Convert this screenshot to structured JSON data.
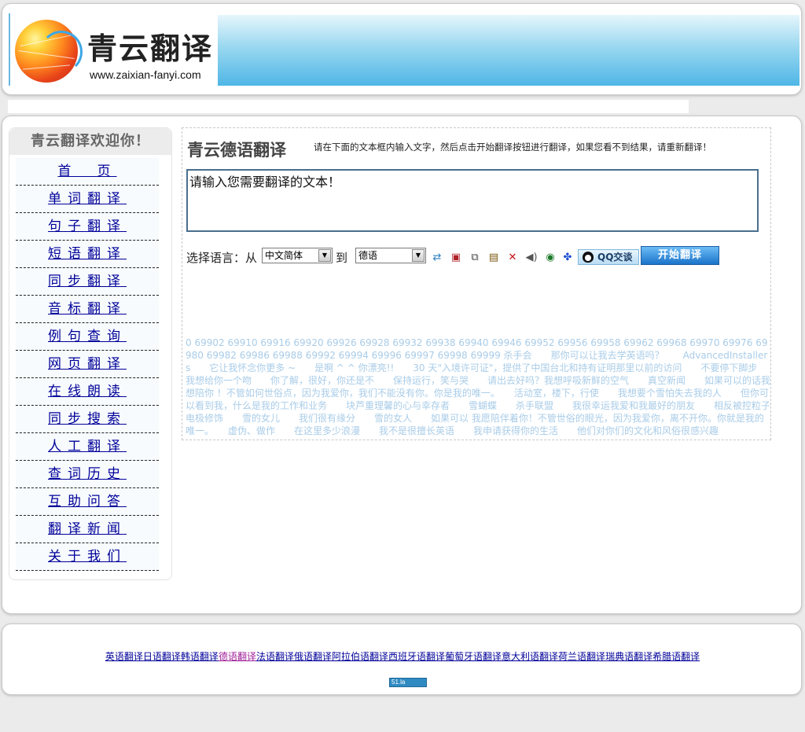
{
  "header": {
    "logo_title": "青云翻译",
    "logo_url": "www.zaixian-fanyi.com"
  },
  "sidebar": {
    "title": "青云翻译欢迎你！",
    "items": [
      {
        "label": "首　页"
      },
      {
        "label": "单词翻译"
      },
      {
        "label": "句子翻译"
      },
      {
        "label": "短语翻译"
      },
      {
        "label": "同步翻译"
      },
      {
        "label": "音标翻译"
      },
      {
        "label": "例句查询"
      },
      {
        "label": "网页翻译"
      },
      {
        "label": "在线朗读"
      },
      {
        "label": "同步搜索"
      },
      {
        "label": "人工翻译"
      },
      {
        "label": "查词历史"
      },
      {
        "label": "互助问答"
      },
      {
        "label": "翻译新闻"
      },
      {
        "label": "关于我们"
      }
    ]
  },
  "translator": {
    "title": "青云德语翻译",
    "hint": "请在下面的文本框内输入文字，然后点击开始翻译按钮进行翻译，如果您看不到结果，请重新翻译！",
    "input_value": "请输入您需要翻译的文本！",
    "select_label": "选择语言：从",
    "to_label": "到",
    "from_lang": "中文简体",
    "to_lang": "德语",
    "qq_label": "QQ交谈",
    "translate_button": "开始翻译"
  },
  "keywords": "0 69902 69910 69916 69920 69926 69928 69932 69938 69940 69946 69952 69956 69958 69962 69968 69970 69976 69980 69982 69986 69988 69992 69994 69996 69997 69998 69999 杀手会　　那你可以让我去学英语吗？　　AdvancedInstallers　　它让我怀念你更多 ~　　是啊 ^ ^ 你漂亮!!　　30 天\"入境许可证\"，提供了中国台北和持有证明那里以前的访问　　不要停下脚步　　我想给你一个吻　　你了解，很好，你还是不　　保持运行，笑与哭　　请出去好吗？我想呼吸新鲜的空气　　真空新闻　　如果可以的话我想陪你 ！不管如何世俗点，因为我爱你，我们不能没有你。你是我的唯一。　　活动室，楼下，行使　　我想要个雪怕失去我的人　　但你可以看到我，什么是我的工作和业务　　块芦重理馨的心与幸存者　　雪蝴蝶　　杀手联盟　　我很幸运我爱和我最好的朋友　　相反被控粒子电极修饰　　雪的女儿　　我们很有缘分　　雪的女人　　如果可以 我愿陪伴着你！不管世俗的眼光，因为我爱你，离不开你。你就是我的唯一。　　虚伪、做作　　在这里多少浪漫　　我不是很擅长英语　　我申请获得你的生活　　他们对你们的文化和风俗很感兴趣",
  "footer": {
    "links": [
      "英语翻译",
      "日语翻译",
      "韩语翻译",
      "德语翻译",
      "法语翻译",
      "俄语翻译",
      "阿拉伯语翻译",
      "西班牙语翻译",
      "葡萄牙语翻译",
      "意大利语翻译",
      "荷兰语翻译",
      "瑞典语翻译",
      "希腊语翻译"
    ],
    "active_link": "德语翻译",
    "counter_label": "51.la"
  }
}
